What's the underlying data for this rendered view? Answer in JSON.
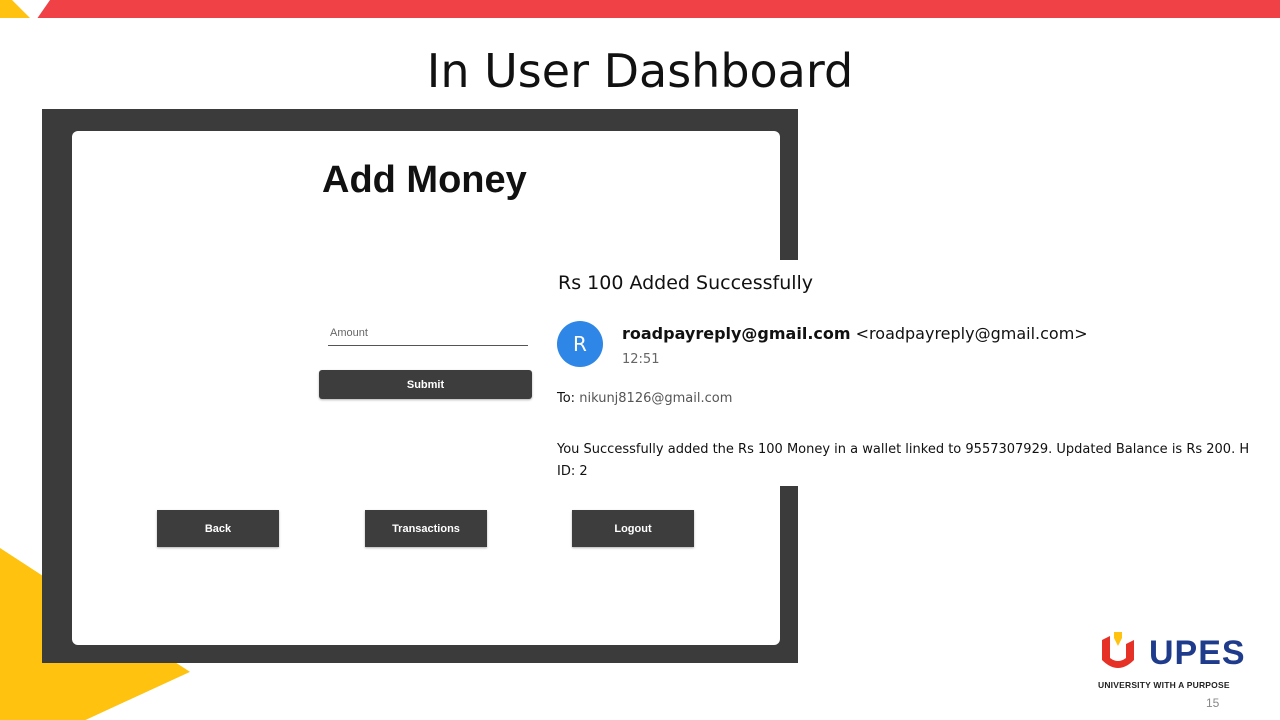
{
  "slide": {
    "title": "In User Dashboard",
    "page_number": "15",
    "accent_colors": {
      "red": "#ef4146",
      "yellow": "#ffc20e"
    }
  },
  "app": {
    "title": "Add Money",
    "amount_placeholder": "Amount",
    "submit_label": "Submit",
    "back_label": "Back",
    "transactions_label": "Transactions",
    "logout_label": "Logout"
  },
  "email": {
    "subject": "Rs 100 Added Successfully",
    "avatar_letter": "R",
    "sender_name": "roadpayreply@gmail.com",
    "sender_address": "<roadpayreply@gmail.com>",
    "time": "12:51",
    "to_label": "To:",
    "to_value": "nikunj8126@gmail.com",
    "body_line1": "You Successfully added the Rs 100 Money in a wallet linked to 9557307929. Updated Balance is Rs 200. H",
    "body_line2": "ID: 2"
  },
  "logo": {
    "name": "UPES",
    "tagline": "UNIVERSITY WITH A PURPOSE",
    "colors": {
      "red": "#e63127",
      "yellow": "#ffc20e",
      "blue": "#1f3b8c"
    }
  }
}
